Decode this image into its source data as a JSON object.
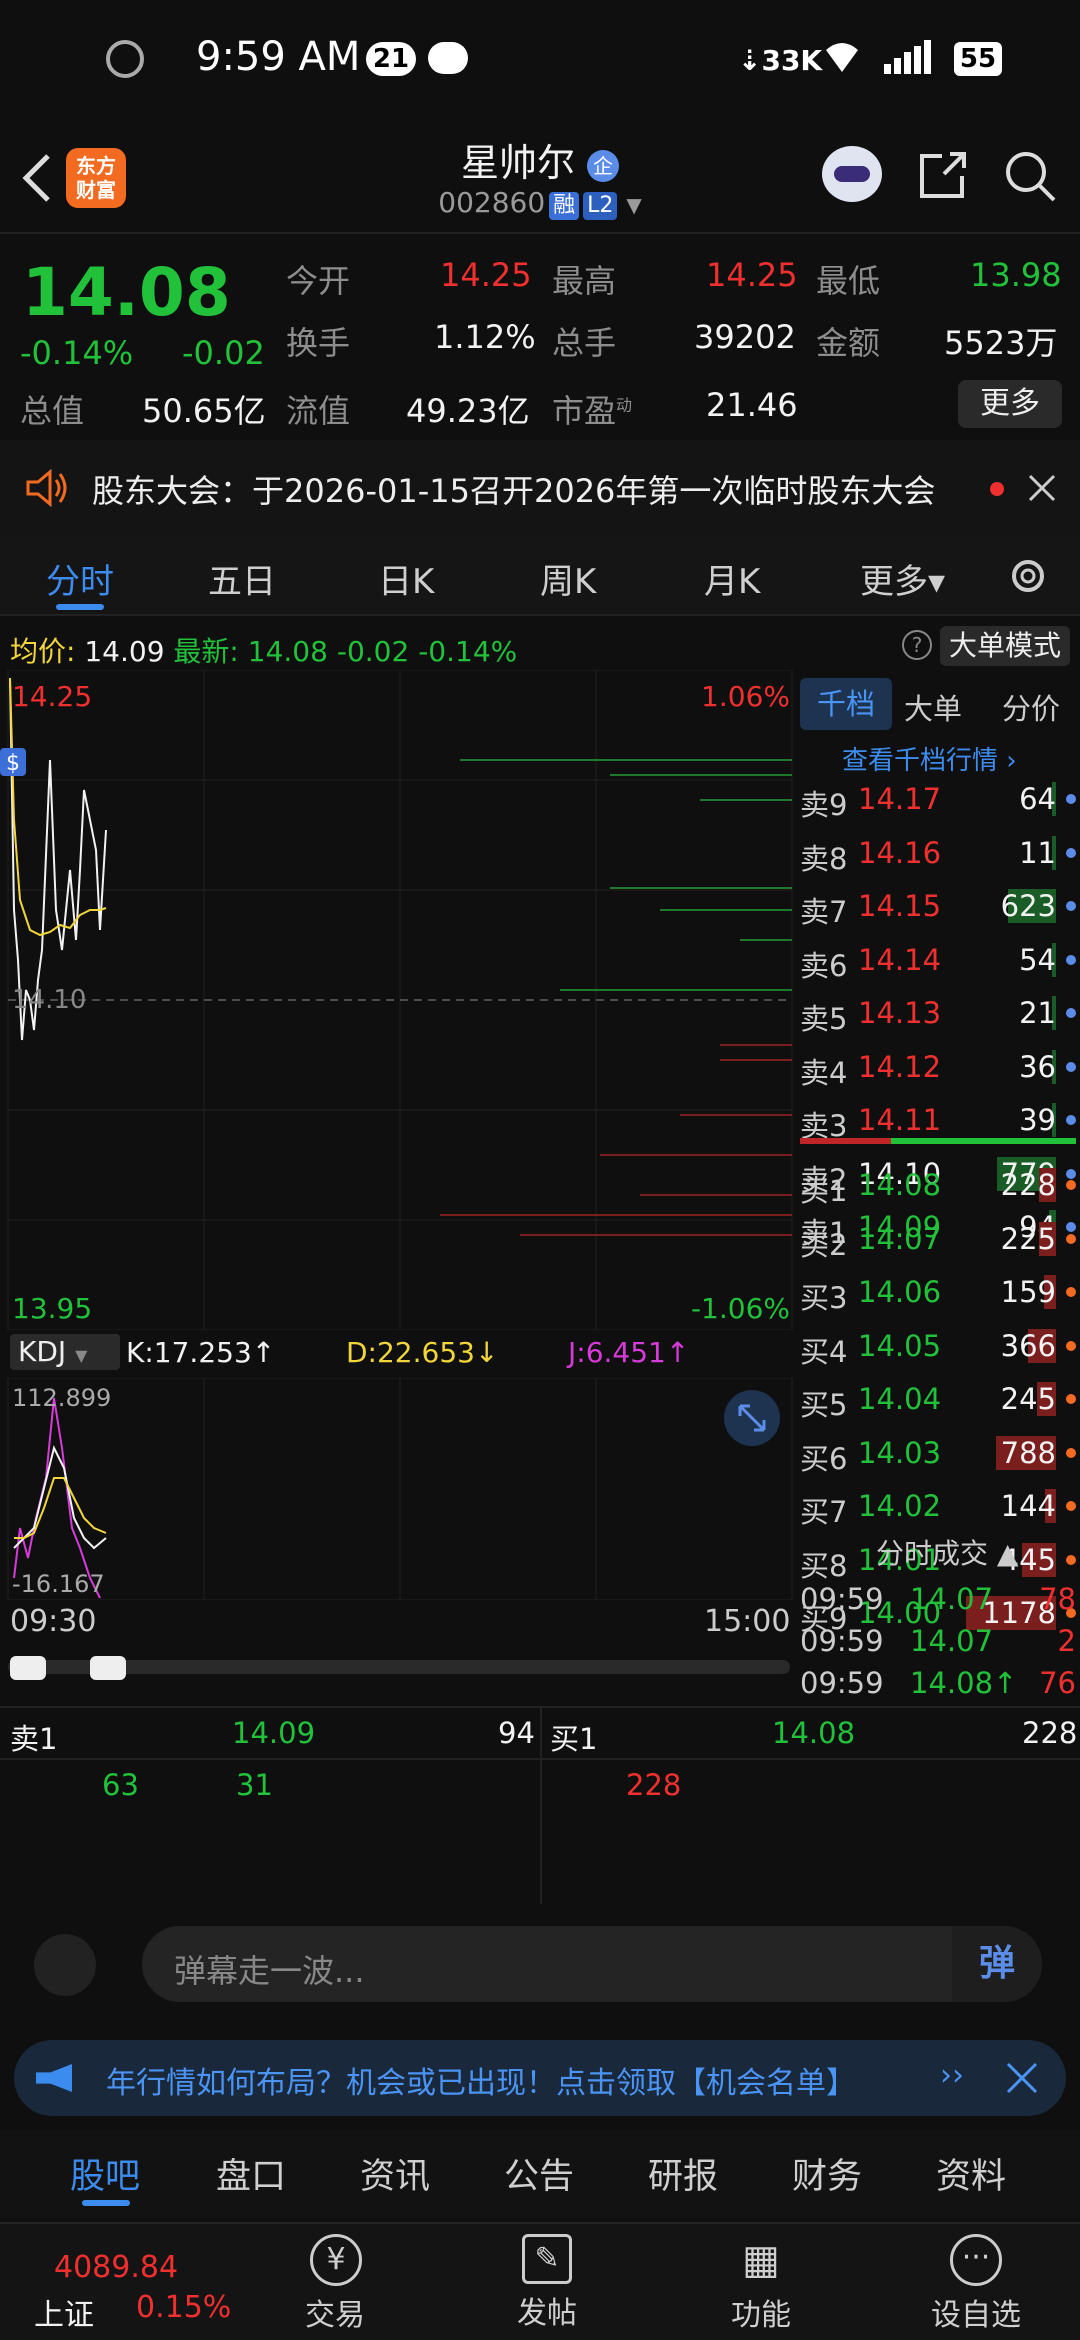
{
  "status": {
    "time": "9:59 AM",
    "notif_count": "21",
    "net_speed": "33K",
    "battery": "55"
  },
  "header": {
    "stock_name": "星帅尔",
    "corp_badge": "企",
    "code": "002860",
    "margin_tag": "融",
    "level_tag": "L2",
    "logo_text": "东方\n财富"
  },
  "quote": {
    "price": "14.08",
    "change_pct": "-0.14%",
    "change": "-0.02",
    "open_label": "今开",
    "open": "14.25",
    "high_label": "最高",
    "high": "14.25",
    "low_label": "最低",
    "low": "13.98",
    "turnover_label": "换手",
    "turnover": "1.12%",
    "volume_label": "总手",
    "volume": "39202",
    "amount_label": "金额",
    "amount": "5523万",
    "mktcap_label": "总值",
    "mktcap": "50.65亿",
    "float_label": "流值",
    "float": "49.23亿",
    "pe_label": "市盈",
    "pe_sup": "动",
    "pe": "21.46",
    "more_button": "更多"
  },
  "notice": {
    "text": "股东大会：于2026-01-15召开2026年第一次临时股东大会"
  },
  "tabs": [
    "分时",
    "五日",
    "日K",
    "周K",
    "月K",
    "更多▾"
  ],
  "avgbar": {
    "avg_label": "均价:",
    "avg": "14.09",
    "latest_label": "最新:",
    "latest": "14.08",
    "chg": "-0.02",
    "chg_pct": "-0.14%",
    "mode_button": "大单模式"
  },
  "chart": {
    "top_price": "14.25",
    "bottom_price": "13.95",
    "top_pct": "1.06%",
    "bottom_pct": "-1.06%",
    "mid_price": "14.10",
    "time_start": "09:30",
    "time_end": "15:00",
    "kdj": {
      "name": "KDJ",
      "k": "K:17.253↑",
      "d": "D:22.653↓",
      "j": "J:6.451↑",
      "max": "112.899",
      "min": "-16.167"
    }
  },
  "order_book": {
    "tabs": [
      "千档",
      "大单",
      "分价"
    ],
    "view_link": "查看千档行情 ›",
    "sells": [
      {
        "label": "卖9",
        "price": "14.17",
        "vol": "64",
        "frac": 0.05
      },
      {
        "label": "卖8",
        "price": "14.16",
        "vol": "11",
        "frac": 0.01
      },
      {
        "label": "卖7",
        "price": "14.15",
        "vol": "623",
        "frac": 0.53
      },
      {
        "label": "卖6",
        "price": "14.14",
        "vol": "54",
        "frac": 0.05
      },
      {
        "label": "卖5",
        "price": "14.13",
        "vol": "21",
        "frac": 0.02
      },
      {
        "label": "卖4",
        "price": "14.12",
        "vol": "36",
        "frac": 0.03
      },
      {
        "label": "卖3",
        "price": "14.11",
        "vol": "39",
        "frac": 0.03
      },
      {
        "label": "卖2",
        "price": "14.10",
        "vol": "779",
        "frac": 0.66
      },
      {
        "label": "卖1",
        "price": "14.09",
        "vol": "94",
        "frac": 0.08
      }
    ],
    "buys": [
      {
        "label": "买1",
        "price": "14.08",
        "vol": "228",
        "frac": 0.19
      },
      {
        "label": "买2",
        "price": "14.07",
        "vol": "225",
        "frac": 0.19
      },
      {
        "label": "买3",
        "price": "14.06",
        "vol": "159",
        "frac": 0.13
      },
      {
        "label": "买4",
        "price": "14.05",
        "vol": "366",
        "frac": 0.31
      },
      {
        "label": "买5",
        "price": "14.04",
        "vol": "245",
        "frac": 0.21
      },
      {
        "label": "买6",
        "price": "14.03",
        "vol": "788",
        "frac": 0.67
      },
      {
        "label": "买7",
        "price": "14.02",
        "vol": "144",
        "frac": 0.12
      },
      {
        "label": "买8",
        "price": "14.01",
        "vol": "445",
        "frac": 0.38
      },
      {
        "label": "买9",
        "price": "14.00",
        "vol": "1178",
        "frac": 1.0
      }
    ],
    "trades_title": "分时成交 ▲",
    "trades": [
      {
        "time": "09:59",
        "price": "14.07",
        "vol": "78"
      },
      {
        "time": "09:59",
        "price": "14.07",
        "vol": "2"
      },
      {
        "time": "09:59",
        "price": "14.08↑",
        "vol": "76"
      }
    ]
  },
  "detail": {
    "sell1_label": "卖1",
    "sell1_price": "14.09",
    "sell1_vol": "94",
    "buy1_label": "买1",
    "buy1_price": "14.08",
    "buy1_vol": "228",
    "sell_queue": [
      "63",
      "31"
    ],
    "buy_queue": [
      "228"
    ]
  },
  "danmu": {
    "placeholder": "弹幕走一波...",
    "send_label": "弹"
  },
  "ad": {
    "text": "年行情如何布局？机会或已出现！点击领取【机会名单】"
  },
  "subtabs": [
    "股吧",
    "盘口",
    "资讯",
    "公告",
    "研报",
    "财务",
    "资料"
  ],
  "footer": {
    "index_value": "4089.84",
    "index_name": "上证",
    "index_pct": "0.15%",
    "items": [
      "交易",
      "发帖",
      "功能",
      "设自选"
    ]
  },
  "colors": {
    "up": "#f0302e",
    "down": "#21c23a",
    "accent": "#3c8cf0"
  }
}
